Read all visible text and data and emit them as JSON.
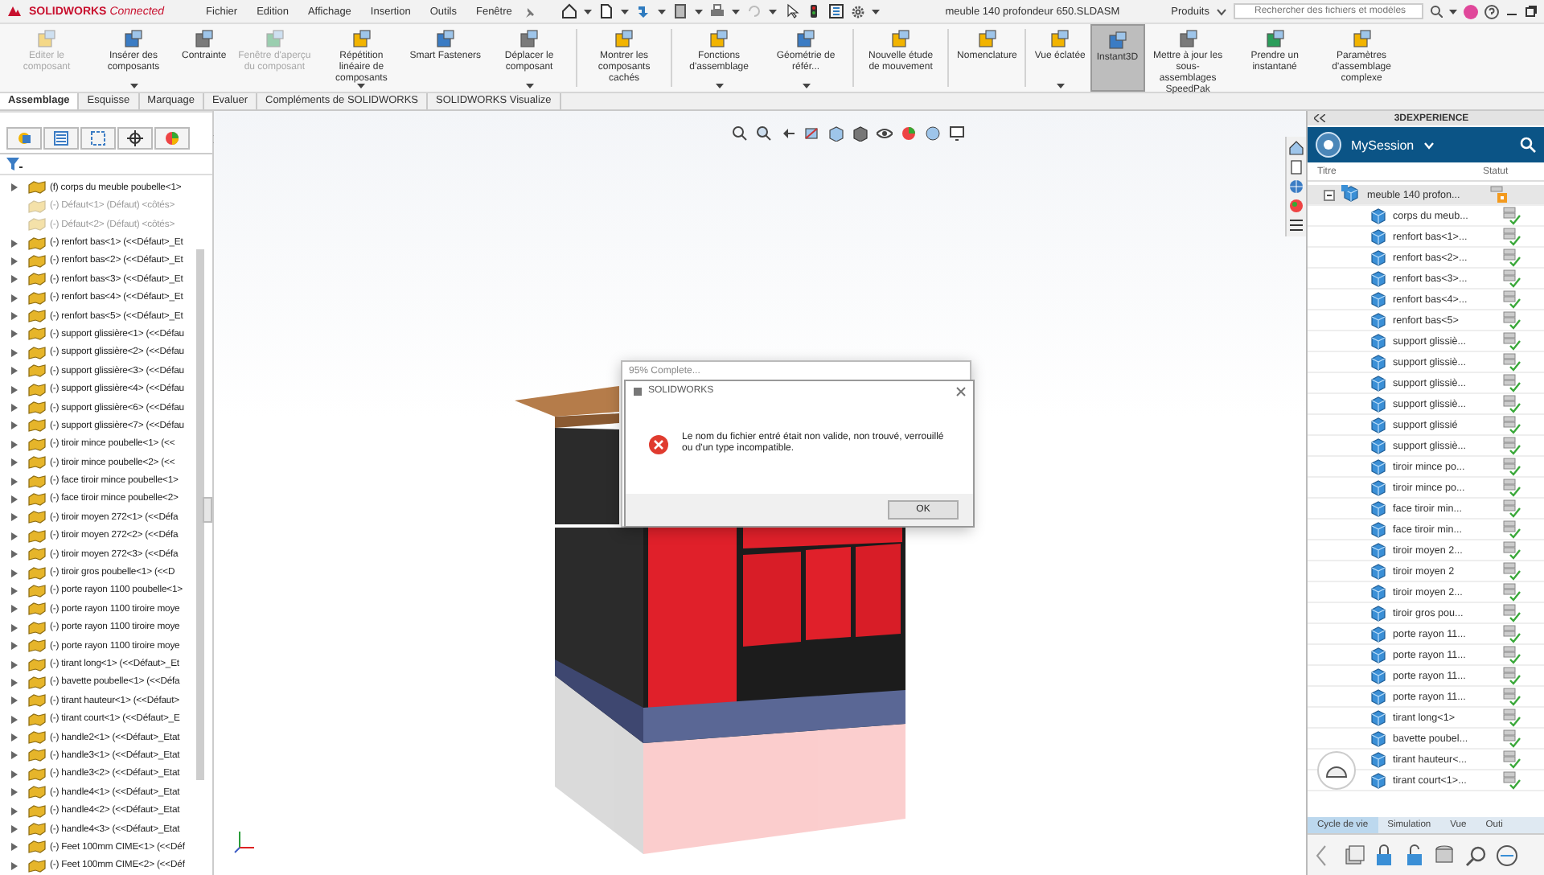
{
  "titlebar": {
    "logo": "**SOLIDWORKS** *Connected*",
    "menu": [
      "Fichier",
      "Edition",
      "Affichage",
      "Insertion",
      "Outils",
      "Fenêtre"
    ],
    "document_title": "meuble 140 profondeur 650.SLDASM",
    "product_menu": "Produits",
    "search": {
      "placeholder": "Rechercher des fichiers et modèles"
    }
  },
  "ribbon_groups": [
    [
      {
        "label": "Editer le composant",
        "disabled": true,
        "caret": false,
        "selected": false
      },
      {
        "label": "Insérer des composants",
        "disabled": false,
        "caret": true,
        "selected": false
      },
      {
        "label": "Contrainte",
        "disabled": false,
        "caret": false,
        "selected": false
      },
      {
        "label": "Fenêtre d'aperçu du composant",
        "disabled": true,
        "caret": false,
        "selected": false
      },
      {
        "label": "Répétition linéaire de composants",
        "disabled": false,
        "caret": true,
        "selected": false
      },
      {
        "label": "Smart Fasteners",
        "disabled": false,
        "caret": false,
        "selected": false
      },
      {
        "label": "Déplacer le composant",
        "disabled": false,
        "caret": true,
        "selected": false
      }
    ],
    [
      {
        "label": "Montrer les composants cachés",
        "disabled": false,
        "caret": false,
        "selected": false
      }
    ],
    [
      {
        "label": "Fonctions d'assemblage",
        "disabled": false,
        "caret": true,
        "selected": false
      },
      {
        "label": "Géométrie de référ...",
        "disabled": false,
        "caret": true,
        "selected": false
      }
    ],
    [
      {
        "label": "Nouvelle étude de mouvement",
        "disabled": false,
        "caret": false,
        "selected": false
      }
    ],
    [
      {
        "label": "Nomenclature",
        "disabled": false,
        "caret": false,
        "selected": false
      }
    ],
    [
      {
        "label": "Vue éclatée",
        "disabled": false,
        "caret": true,
        "selected": false
      },
      {
        "label": "Instant3D",
        "disabled": false,
        "caret": false,
        "selected": true
      },
      {
        "label": "Mettre à jour les sous-assemblages SpeedPak",
        "disabled": false,
        "caret": false,
        "selected": false
      },
      {
        "label": "Prendre un instantané",
        "disabled": false,
        "caret": false,
        "selected": false
      },
      {
        "label": "Paramètres d'assemblage complexe",
        "disabled": false,
        "caret": false,
        "selected": false
      }
    ]
  ],
  "command_tabs": [
    {
      "label": "Assemblage",
      "selected": true
    },
    {
      "label": "Esquisse",
      "selected": false
    },
    {
      "label": "Marquage",
      "selected": false
    },
    {
      "label": "Evaluer",
      "selected": false
    },
    {
      "label": "Compléments de SOLIDWORKS",
      "selected": false
    },
    {
      "label": "SOLIDWORKS Visualize",
      "selected": false
    }
  ],
  "feature_tree": {
    "items": [
      {
        "label": "(f) corps du meuble poubelle<1>",
        "disabled": false,
        "expandable": true
      },
      {
        "label": "(-) Défaut<1> (Défaut) <côtés>",
        "disabled": true,
        "expandable": false
      },
      {
        "label": "(-) Défaut<2> (Défaut) <côtés>",
        "disabled": true,
        "expandable": false
      },
      {
        "label": "(-) renfort bas<1> (<<Défaut>_Et",
        "disabled": false,
        "expandable": true
      },
      {
        "label": "(-) renfort bas<2> (<<Défaut>_Et",
        "disabled": false,
        "expandable": true
      },
      {
        "label": "(-) renfort bas<3> (<<Défaut>_Et",
        "disabled": false,
        "expandable": true
      },
      {
        "label": "(-) renfort bas<4> (<<Défaut>_Et",
        "disabled": false,
        "expandable": true
      },
      {
        "label": "(-) renfort bas<5> (<<Défaut>_Et",
        "disabled": false,
        "expandable": true
      },
      {
        "label": "(-) support glissière<1> (<<Défau",
        "disabled": false,
        "expandable": true
      },
      {
        "label": "(-) support glissière<2> (<<Défau",
        "disabled": false,
        "expandable": true
      },
      {
        "label": "(-) support glissière<3> (<<Défau",
        "disabled": false,
        "expandable": true
      },
      {
        "label": "(-) support glissière<4> (<<Défau",
        "disabled": false,
        "expandable": true
      },
      {
        "label": "(-) support glissière<6> (<<Défau",
        "disabled": false,
        "expandable": true
      },
      {
        "label": "(-) support glissière<7> (<<Défau",
        "disabled": false,
        "expandable": true
      },
      {
        "label": "(-) tiroir mince poubelle<1> (<<",
        "disabled": false,
        "expandable": true
      },
      {
        "label": "(-) tiroir mince poubelle<2> (<<",
        "disabled": false,
        "expandable": true
      },
      {
        "label": "(-) face tiroir mince poubelle<1>",
        "disabled": false,
        "expandable": true
      },
      {
        "label": "(-) face tiroir mince poubelle<2>",
        "disabled": false,
        "expandable": true
      },
      {
        "label": "(-) tiroir moyen 272<1> (<<Défa",
        "disabled": false,
        "expandable": true
      },
      {
        "label": "(-) tiroir moyen 272<2> (<<Défa",
        "disabled": false,
        "expandable": true
      },
      {
        "label": "(-) tiroir moyen 272<3> (<<Défa",
        "disabled": false,
        "expandable": true
      },
      {
        "label": "(-) tiroir gros poubelle<1> (<<D",
        "disabled": false,
        "expandable": true
      },
      {
        "label": "(-) porte rayon 1100 poubelle<1>",
        "disabled": false,
        "expandable": true
      },
      {
        "label": "(-) porte rayon 1100 tiroire moye",
        "disabled": false,
        "expandable": true
      },
      {
        "label": "(-) porte rayon 1100 tiroire moye",
        "disabled": false,
        "expandable": true
      },
      {
        "label": "(-) porte rayon 1100 tiroire moye",
        "disabled": false,
        "expandable": true
      },
      {
        "label": "(-) tirant long<1> (<<Défaut>_Et",
        "disabled": false,
        "expandable": true
      },
      {
        "label": "(-) bavette poubelle<1> (<<Défa",
        "disabled": false,
        "expandable": true
      },
      {
        "label": "(-) tirant hauteur<1> (<<Défaut>",
        "disabled": false,
        "expandable": true
      },
      {
        "label": "(-) tirant court<1> (<<Défaut>_E",
        "disabled": false,
        "expandable": true
      },
      {
        "label": "(-) handle2<1> (<<Défaut>_Etat",
        "disabled": false,
        "expandable": true
      },
      {
        "label": "(-) handle3<1> (<<Défaut>_Etat",
        "disabled": false,
        "expandable": true
      },
      {
        "label": "(-) handle3<2> (<<Défaut>_Etat",
        "disabled": false,
        "expandable": true
      },
      {
        "label": "(-) handle4<1> (<<Défaut>_Etat",
        "disabled": false,
        "expandable": true
      },
      {
        "label": "(-) handle4<2> (<<Défaut>_Etat",
        "disabled": false,
        "expandable": true
      },
      {
        "label": "(-) handle4<3> (<<Défaut>_Etat",
        "disabled": false,
        "expandable": true
      },
      {
        "label": "(-) Feet 100mm CIME<1> (<<Déf",
        "disabled": false,
        "expandable": true
      },
      {
        "label": "(-) Feet 100mm CIME<2> (<<Déf",
        "disabled": false,
        "expandable": true
      }
    ]
  },
  "dialog": {
    "progress_title": "95% Complete...",
    "title": "SOLIDWORKS",
    "message": "Le nom du fichier entré était non valide, non trouvé, verrouillé ou d'un type incompatible.",
    "button": "OK"
  },
  "experience_panel": {
    "header": "3DEXPERIENCE",
    "session": "MySession",
    "columns": [
      "Titre",
      "Statut"
    ],
    "tree": [
      {
        "title": "meuble 140 profon...",
        "expanded": true,
        "children": [
          {
            "title": "corps du meub..."
          },
          {
            "title": "renfort bas<1>..."
          },
          {
            "title": "renfort bas<2>..."
          },
          {
            "title": "renfort bas<3>..."
          },
          {
            "title": "renfort bas<4>..."
          },
          {
            "title": "renfort bas<5>"
          },
          {
            "title": "support glissiè..."
          },
          {
            "title": "support glissiè..."
          },
          {
            "title": "support glissiè..."
          },
          {
            "title": "support glissiè..."
          },
          {
            "title": "support glissié"
          },
          {
            "title": "support glissiè..."
          },
          {
            "title": "tiroir mince po..."
          },
          {
            "title": "tiroir mince po..."
          },
          {
            "title": "face tiroir min..."
          },
          {
            "title": "face tiroir min..."
          },
          {
            "title": "tiroir moyen 2..."
          },
          {
            "title": "tiroir moyen 2"
          },
          {
            "title": "tiroir moyen 2..."
          },
          {
            "title": "tiroir gros pou..."
          },
          {
            "title": "porte rayon 11..."
          },
          {
            "title": "porte rayon 11..."
          },
          {
            "title": "porte rayon 11..."
          },
          {
            "title": "porte rayon 11..."
          },
          {
            "title": "tirant long<1>"
          },
          {
            "title": "bavette poubel..."
          },
          {
            "title": "tirant hauteur<..."
          },
          {
            "title": "tirant court<1>..."
          }
        ]
      }
    ],
    "tabs": [
      {
        "label": "Cycle de vie",
        "selected": true
      },
      {
        "label": "Simulation",
        "selected": false
      },
      {
        "label": "Vue",
        "selected": false
      },
      {
        "label": "Outi",
        "selected": false
      }
    ]
  }
}
